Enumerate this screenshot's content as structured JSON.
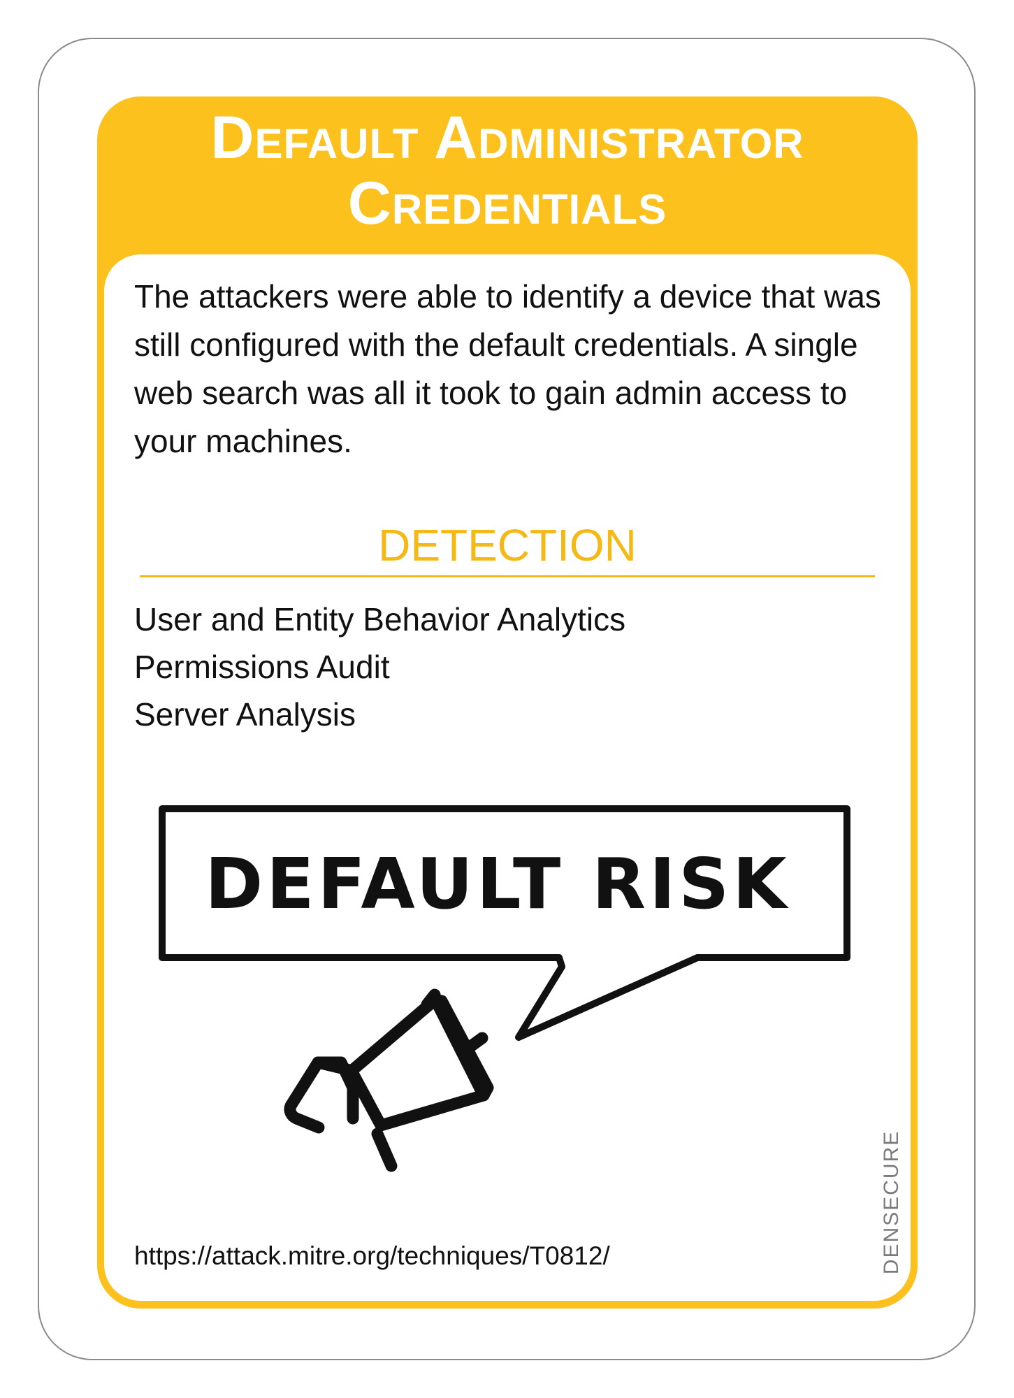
{
  "card": {
    "title": "Default Administrator Credentials",
    "description": "The attackers were able to identify a device that was still configured with the default credentials. A single web search was all it took to gain admin access to your machines.",
    "detection_heading": "DETECTION",
    "detection_items": [
      "User and Entity Behavior Analytics",
      "Permissions Audit",
      "Server Analysis"
    ],
    "bubble_text": "DEFAULT RISK",
    "illustration_icon": "megaphone-icon",
    "source_url": "https://attack.mitre.org/techniques/T0812/",
    "brand": "DENSECURE"
  },
  "colors": {
    "accent": "#FDC11E",
    "heading_accent": "#F5B915",
    "text": "#111111",
    "brand_text": "#7a7a7a",
    "outline": "#8a8a8a"
  }
}
